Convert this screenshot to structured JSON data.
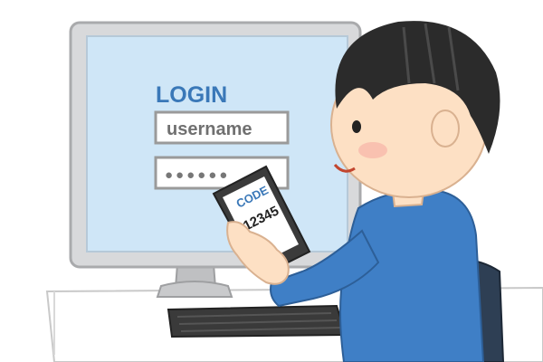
{
  "login_screen": {
    "title": "LOGIN",
    "username_placeholder": "username",
    "password_mask": "●●●●●●"
  },
  "phone": {
    "code_label": "CODE",
    "code_value": "12345"
  },
  "colors": {
    "monitor_frame": "#d8d9db",
    "screen": "#cfe6f7",
    "login_title": "#3a78b8",
    "field_border": "#9a9a9a",
    "shirt": "#3f7fc6",
    "hair": "#2b2b2b",
    "skin": "#fde0c4",
    "chair": "#2e3f54",
    "phone_body": "#3b3b3b",
    "desk": "#ffffff",
    "keyboard": "#3a3a3a"
  }
}
